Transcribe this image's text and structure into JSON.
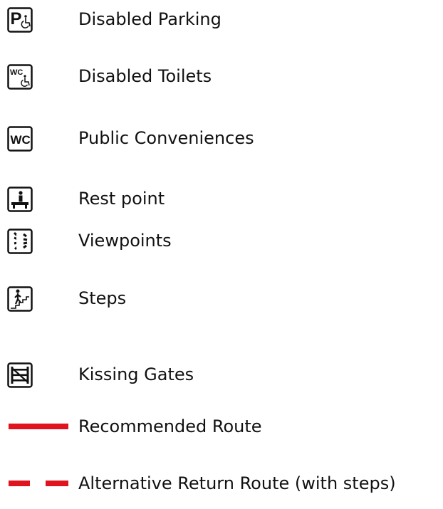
{
  "legend": {
    "items": [
      {
        "icon": "disabled-parking-icon",
        "label": "Disabled Parking"
      },
      {
        "icon": "disabled-toilets-icon",
        "label": "Disabled Toilets"
      },
      {
        "icon": "public-conveniences-icon",
        "label": "Public Conveniences"
      },
      {
        "icon": "rest-point-icon",
        "label": "Rest point"
      },
      {
        "icon": "viewpoints-icon",
        "label": "Viewpoints"
      },
      {
        "icon": "steps-icon",
        "label": "Steps"
      },
      {
        "icon": "kissing-gates-icon",
        "label": "Kissing Gates"
      }
    ],
    "routes": [
      {
        "style": "solid",
        "color": "#e0141e",
        "label": "Recommended Route"
      },
      {
        "style": "dashed",
        "color": "#e0141e",
        "label": "Alternative Return Route (with steps)"
      }
    ]
  }
}
